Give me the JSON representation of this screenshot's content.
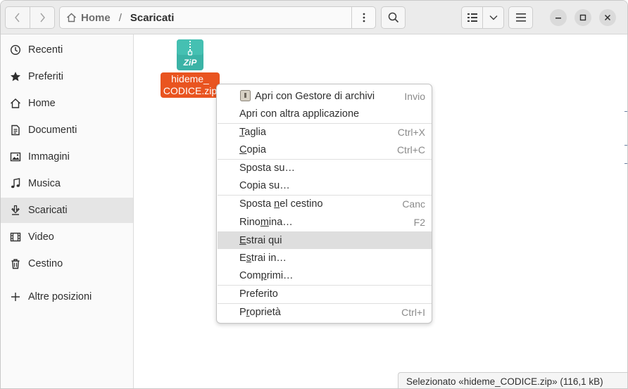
{
  "header": {
    "breadcrumb_home": "Home",
    "breadcrumb_sep": "/",
    "breadcrumb_current": "Scaricati"
  },
  "sidebar": {
    "items": [
      {
        "label": "Recenti",
        "icon": "clock-icon"
      },
      {
        "label": "Preferiti",
        "icon": "star-icon"
      },
      {
        "label": "Home",
        "icon": "home-icon"
      },
      {
        "label": "Documenti",
        "icon": "document-icon"
      },
      {
        "label": "Immagini",
        "icon": "image-icon"
      },
      {
        "label": "Musica",
        "icon": "music-icon"
      },
      {
        "label": "Scaricati",
        "icon": "download-icon",
        "active": true
      },
      {
        "label": "Video",
        "icon": "video-icon"
      },
      {
        "label": "Cestino",
        "icon": "trash-icon"
      },
      {
        "label": "Altre posizioni",
        "icon": "plus-icon"
      }
    ]
  },
  "file": {
    "icon_text": "ZiP",
    "name_line1": "hideme_",
    "name_line2": "CODICE.zip"
  },
  "context_menu": {
    "items": [
      {
        "label": "Apri con Gestore di archivi",
        "accel": "Invio"
      },
      {
        "label": "Apri con altra applicazione",
        "accel": ""
      },
      {
        "label_pre": "",
        "label_u": "T",
        "label_post": "aglia",
        "accel": "Ctrl+X"
      },
      {
        "label_pre": "",
        "label_u": "C",
        "label_post": "opia",
        "accel": "Ctrl+C"
      },
      {
        "label": "Sposta su…",
        "accel": ""
      },
      {
        "label": "Copia su…",
        "accel": ""
      },
      {
        "label_pre": "Sposta ",
        "label_u": "n",
        "label_post": "el cestino",
        "accel": "Canc"
      },
      {
        "label_pre": "Rino",
        "label_u": "m",
        "label_post": "ina…",
        "accel": "F2"
      },
      {
        "label_pre": "",
        "label_u": "E",
        "label_post": "strai qui",
        "accel": "",
        "highlighted": true
      },
      {
        "label_pre": "E",
        "label_u": "s",
        "label_post": "trai in…",
        "accel": ""
      },
      {
        "label_pre": "Com",
        "label_u": "p",
        "label_post": "rimi…",
        "accel": ""
      },
      {
        "label": "Preferito",
        "accel": ""
      },
      {
        "label_pre": "P",
        "label_u": "r",
        "label_post": "oprietà",
        "accel": "Ctrl+I"
      }
    ]
  },
  "status": {
    "text": "Selezionato «hideme_CODICE.zip» (116,1 kB)"
  },
  "colors": {
    "selection": "#e95420",
    "zip_icon": "#3bb3a6"
  }
}
